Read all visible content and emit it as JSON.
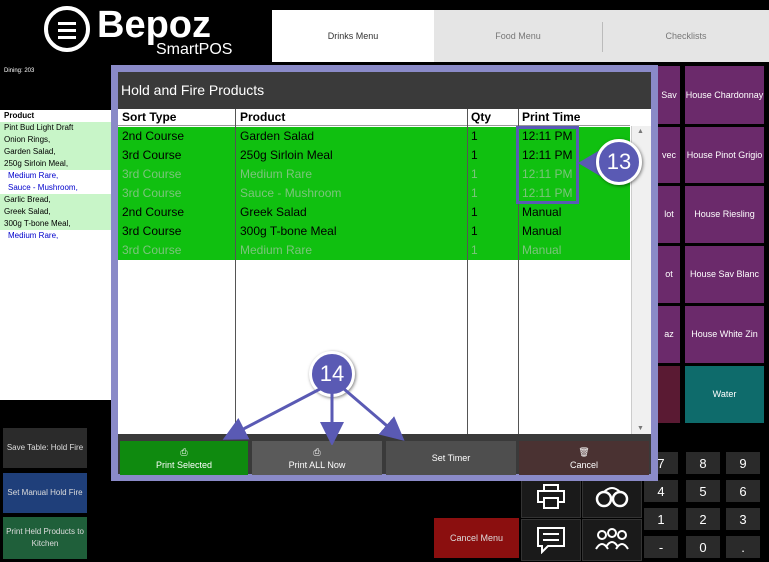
{
  "header": {
    "logo_text": "Bepoz",
    "logo_sub": "SmartPOS",
    "dining": "Dining: 203"
  },
  "tabs": [
    {
      "label": "Drinks Menu",
      "active": true
    },
    {
      "label": "Food Menu",
      "active": false
    },
    {
      "label": "Checklists",
      "active": false
    }
  ],
  "order": {
    "header": "Product",
    "lines": [
      {
        "text": "Pint Bud Light Draft",
        "style": "g"
      },
      {
        "text": "Onion Rings,",
        "style": "g"
      },
      {
        "text": "Garden Salad,",
        "style": "g"
      },
      {
        "text": "250g Sirloin Meal,",
        "style": "g"
      },
      {
        "text": "Medium Rare,",
        "style": "m"
      },
      {
        "text": "Sauce - Mushroom,",
        "style": "m"
      },
      {
        "text": "Garlic Bread,",
        "style": "g"
      },
      {
        "text": "Greek Salad,",
        "style": "g"
      },
      {
        "text": "300g T-bone Meal,",
        "style": "g"
      },
      {
        "text": "Medium Rare,",
        "style": "m"
      }
    ]
  },
  "left_buttons": [
    {
      "label": "Save Table: Hold Fire"
    },
    {
      "label": "Set Manual Hold Fire"
    },
    {
      "label": "Print Held Products to Kitchen"
    }
  ],
  "right_tiles": [
    {
      "label": "Sav"
    },
    {
      "label": "House Chardonnay"
    },
    {
      "label": "vec"
    },
    {
      "label": "House Pinot Grigio"
    },
    {
      "label": "lot"
    },
    {
      "label": "House Riesling"
    },
    {
      "label": "ot"
    },
    {
      "label": "House Sav Blanc"
    },
    {
      "label": "az"
    },
    {
      "label": "House White Zin"
    },
    {
      "label": "Water"
    }
  ],
  "keypad": [
    "7",
    "8",
    "9",
    "4",
    "5",
    "6",
    "1",
    "2",
    "3",
    "-",
    "0",
    "."
  ],
  "cancel_menu": "Cancel Menu",
  "modal": {
    "title": "Hold and Fire Products",
    "columns": [
      "Sort Type",
      "Product",
      "Qty",
      "Print Time"
    ],
    "rows": [
      {
        "sort": "2nd Course",
        "product": "Garden Salad",
        "qty": "1",
        "time": "12:11 PM",
        "faded": false
      },
      {
        "sort": "3rd Course",
        "product": "250g Sirloin Meal",
        "qty": "1",
        "time": "12:11 PM",
        "faded": false
      },
      {
        "sort": "3rd Course",
        "product": "Medium Rare",
        "qty": "1",
        "time": "12:11 PM",
        "faded": true
      },
      {
        "sort": "3rd Course",
        "product": "Sauce - Mushroom",
        "qty": "1",
        "time": "12:11 PM",
        "faded": true
      },
      {
        "sort": "2nd Course",
        "product": "Greek Salad",
        "qty": "1",
        "time": "Manual",
        "faded": false
      },
      {
        "sort": "3rd Course",
        "product": "300g T-bone Meal",
        "qty": "1",
        "time": "Manual",
        "faded": false
      },
      {
        "sort": "3rd Course",
        "product": "Medium Rare",
        "qty": "1",
        "time": "Manual",
        "faded": true
      }
    ],
    "buttons": {
      "print_selected": "Print Selected",
      "print_all": "Print ALL Now",
      "set_timer": "Set Timer",
      "cancel": "Cancel"
    }
  },
  "callouts": {
    "a": "13",
    "b": "14"
  },
  "colors": {
    "row_green": "#10c010",
    "callout": "#5a5ab4",
    "tile_purple": "#6b2a6b",
    "tile_teal": "#0e6b6b",
    "cancel_red": "#8b0f0f"
  }
}
